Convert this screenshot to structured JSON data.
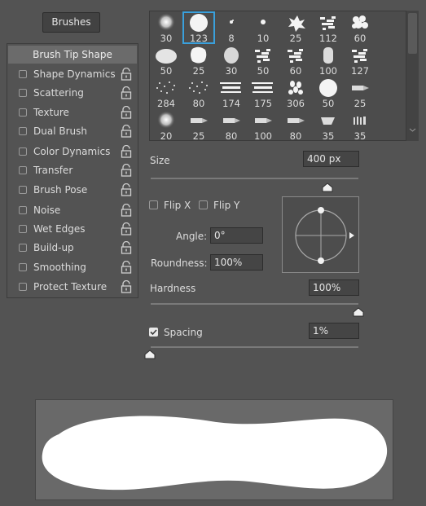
{
  "brushes_button": "Brushes",
  "brush_tip_shape": "Brush Tip Shape",
  "options": [
    {
      "label": "Shape Dynamics"
    },
    {
      "label": "Scattering"
    },
    {
      "label": "Texture"
    },
    {
      "label": "Dual Brush"
    },
    {
      "label": "Color Dynamics"
    },
    {
      "label": "Transfer"
    },
    {
      "label": "Brush Pose"
    },
    {
      "label": "Noise"
    },
    {
      "label": "Wet Edges"
    },
    {
      "label": "Build-up"
    },
    {
      "label": "Smoothing"
    },
    {
      "label": "Protect Texture"
    }
  ],
  "presets": [
    {
      "size": "30",
      "kind": "soft"
    },
    {
      "size": "123",
      "kind": "hard",
      "selected": true
    },
    {
      "size": "8",
      "kind": "tiny"
    },
    {
      "size": "10",
      "kind": "dot"
    },
    {
      "size": "25",
      "kind": "splat"
    },
    {
      "size": "112",
      "kind": "scatter"
    },
    {
      "size": "60",
      "kind": "blob"
    },
    {
      "size": "50",
      "kind": "chalk"
    },
    {
      "size": "25",
      "kind": "hard-rough"
    },
    {
      "size": "30",
      "kind": "rough"
    },
    {
      "size": "50",
      "kind": "scatter"
    },
    {
      "size": "60",
      "kind": "scatter"
    },
    {
      "size": "100",
      "kind": "pill"
    },
    {
      "size": "127",
      "kind": "scatter"
    },
    {
      "size": "284",
      "kind": "spray"
    },
    {
      "size": "80",
      "kind": "spray"
    },
    {
      "size": "174",
      "kind": "streak"
    },
    {
      "size": "175",
      "kind": "streak"
    },
    {
      "size": "306",
      "kind": "leaves"
    },
    {
      "size": "50",
      "kind": "hard"
    },
    {
      "size": "25",
      "kind": "pencil"
    },
    {
      "size": "20",
      "kind": "soft"
    },
    {
      "size": "25",
      "kind": "pencil"
    },
    {
      "size": "80",
      "kind": "pencil"
    },
    {
      "size": "100",
      "kind": "pencil"
    },
    {
      "size": "80",
      "kind": "pencil"
    },
    {
      "size": "35",
      "kind": "marker"
    },
    {
      "size": "35",
      "kind": "bristle"
    }
  ],
  "size": {
    "label": "Size",
    "value": "400 px",
    "slider_fraction": 0.9
  },
  "flip_x": "Flip X",
  "flip_y": "Flip Y",
  "angle": {
    "label": "Angle:",
    "value": "0°"
  },
  "roundness": {
    "label": "Roundness:",
    "value": "100%"
  },
  "hardness": {
    "label": "Hardness",
    "value": "100%",
    "slider_fraction": 1.0
  },
  "spacing": {
    "label": "Spacing",
    "value": "1%",
    "checked": true,
    "slider_fraction": 0.0
  },
  "colors": {
    "accent": "#3aa0dc",
    "panel": "#535353",
    "field": "#454545",
    "preview": "#696969"
  }
}
